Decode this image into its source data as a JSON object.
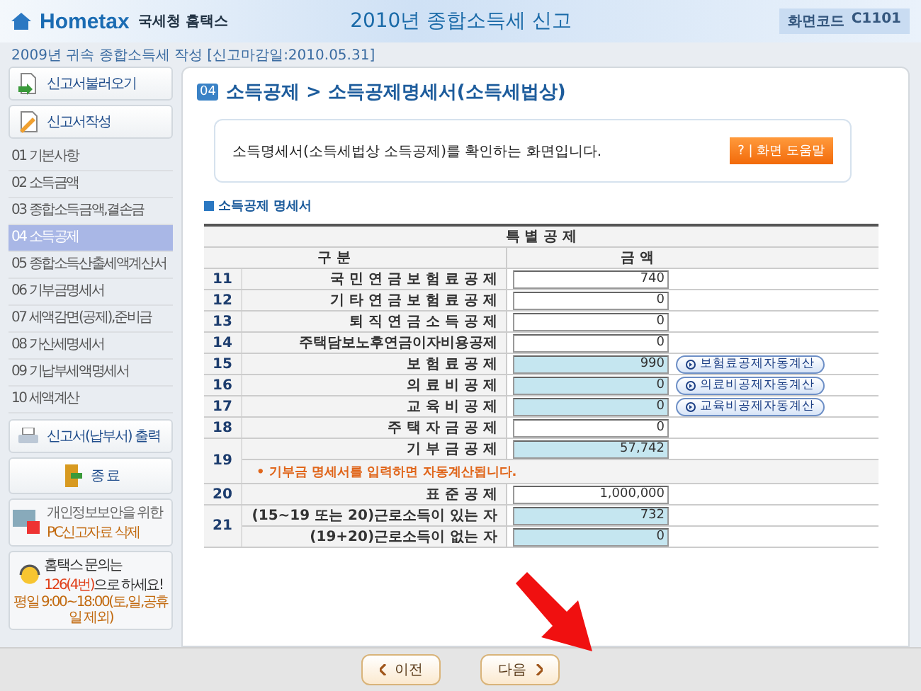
{
  "header": {
    "logo": "Hometax",
    "org": "국세청 홈택스",
    "title": "2010년 종합소득세 신고",
    "code_label": "화면코드",
    "code": "C1101"
  },
  "subheader": "2009년 귀속 종합소득세 작성 [신고마감일:2010.05.31]",
  "sidebar": {
    "top_buttons": [
      {
        "label": "신고서불러오기",
        "kind": "load"
      },
      {
        "label": "신고서작성",
        "kind": "write"
      }
    ],
    "menu": [
      {
        "label": "01 기본사항",
        "selected": false
      },
      {
        "label": "02 소득금액",
        "selected": false
      },
      {
        "label": "03 종합소득금액,결손금",
        "selected": false
      },
      {
        "label": "04 소득공제",
        "selected": true
      },
      {
        "label": "05 종합소득산출세액계산서",
        "selected": false
      },
      {
        "label": "06 기부금명세서",
        "selected": false
      },
      {
        "label": "07 세액감면(공제),준비금",
        "selected": false
      },
      {
        "label": "08 가산세명세서",
        "selected": false
      },
      {
        "label": "09 기납부세액명세서",
        "selected": false
      },
      {
        "label": "10 세액계산",
        "selected": false
      }
    ],
    "print_button": "신고서(납부서) 출력",
    "exit_button": "종 료",
    "delete_box": {
      "note": "개인정보보안을 위한",
      "label": "PC신고자료 삭제"
    },
    "help_box": {
      "line1": "홈택스 문의는",
      "phone": "126(4번)",
      "line2": "으로 하세요!",
      "hours": "평일 9:00~18:00(토,일,공휴일 제외)"
    }
  },
  "main": {
    "badge": "04",
    "title": "소득공제 > 소득공제명세서(소득세법상)",
    "description": "소득명세서(소득세법상 소득공제)를 확인하는 화면입니다.",
    "help_button": "? | 화면 도움말",
    "section": "소득공제 명세서",
    "table": {
      "group_header": "특 별 공 제",
      "col_label": "구 분",
      "col_amount": "금 액",
      "rows": [
        {
          "no": "11",
          "lines": [
            {
              "kind": "field",
              "label": "국 민 연 금 보 험 료 공 제",
              "value": "740",
              "shaded": false
            }
          ]
        },
        {
          "no": "12",
          "lines": [
            {
              "kind": "field",
              "label": "기 타 연 금 보 험 료 공 제",
              "value": "0",
              "shaded": false
            }
          ]
        },
        {
          "no": "13",
          "lines": [
            {
              "kind": "field",
              "label": "퇴 직 연 금 소 득 공 제",
              "value": "0",
              "shaded": false
            }
          ]
        },
        {
          "no": "14",
          "lines": [
            {
              "kind": "field",
              "label": "주택담보노후연금이자비용공제",
              "value": "0",
              "shaded": false
            }
          ]
        },
        {
          "no": "15",
          "lines": [
            {
              "kind": "field",
              "label": "보 험 료 공 제",
              "value": "990",
              "shaded": true,
              "button": "보험료공제자동계산"
            }
          ]
        },
        {
          "no": "16",
          "lines": [
            {
              "kind": "field",
              "label": "의 료 비 공 제",
              "value": "0",
              "shaded": true,
              "button": "의료비공제자동계산"
            }
          ]
        },
        {
          "no": "17",
          "lines": [
            {
              "kind": "field",
              "label": "교 육 비 공 제",
              "value": "0",
              "shaded": true,
              "button": "교육비공제자동계산"
            }
          ]
        },
        {
          "no": "18",
          "lines": [
            {
              "kind": "field",
              "label": "주 택 자 금 공 제",
              "value": "0",
              "shaded": false
            }
          ]
        },
        {
          "no": "19",
          "lines": [
            {
              "kind": "field",
              "label": "기 부 금 공 제",
              "value": "57,742",
              "shaded": true
            },
            {
              "kind": "note",
              "label": "• 기부금 명세서를 입력하면 자동계산됩니다."
            }
          ]
        },
        {
          "no": "20",
          "lines": [
            {
              "kind": "field",
              "label": "표 준 공 제",
              "value": "1,000,000",
              "shaded": false
            }
          ]
        },
        {
          "no": "21",
          "lines": [
            {
              "kind": "field",
              "label": "(15~19 또는 20)근로소득이 있는 자",
              "value": "732",
              "shaded": true
            },
            {
              "kind": "field",
              "label": "(19+20)근로소득이 없는 자",
              "value": "0",
              "shaded": true
            }
          ]
        }
      ]
    }
  },
  "footer": {
    "prev": "이전",
    "next": "다음"
  }
}
